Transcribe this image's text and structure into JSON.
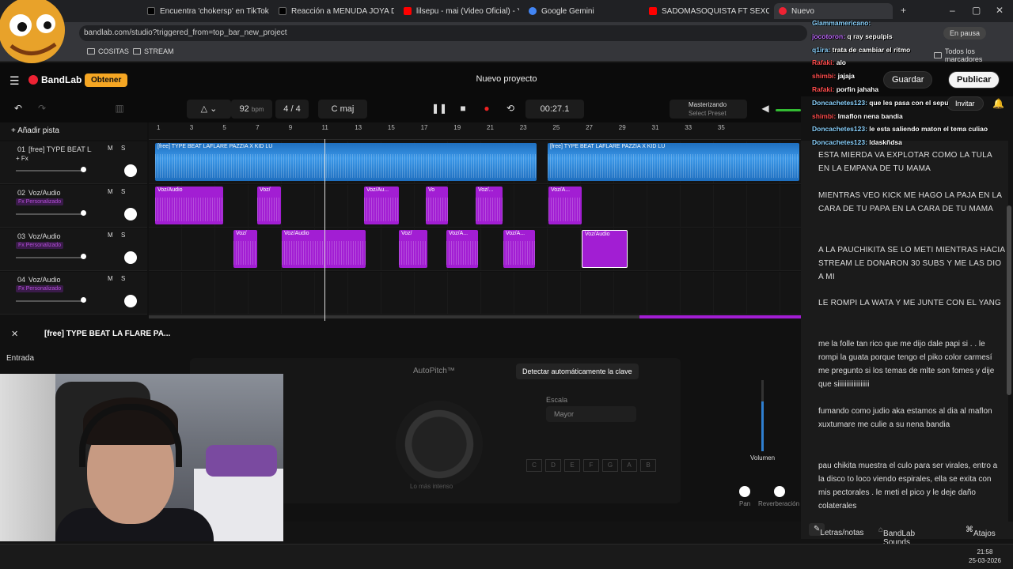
{
  "browser": {
    "tabs": [
      {
        "title": "Encuentra 'chokersp' en TikTok",
        "color": "#000000"
      },
      {
        "title": "Reacción a MENUDA JOYA DYS",
        "color": "#000000"
      },
      {
        "title": "lilsepu - mai (Video Oficial) - Yo",
        "color": "#ff0000"
      },
      {
        "title": "Google Gemini",
        "color": "#4285f4"
      },
      {
        "title": "SADOMASOQUISTA FT SEXO //",
        "color": "#ff0000"
      },
      {
        "title": "Nuevo",
        "color": "#e23"
      }
    ],
    "url": "bandlab.com/studio?triggered_from=top_bar_new_project",
    "paused_label": "En pausa",
    "bookmarks": [
      "COSITAS",
      "STREAM"
    ],
    "all_bookmarks": "Todos los marcadores"
  },
  "app": {
    "logo": "BandLab",
    "get_label": "Obtener",
    "project_title": "Nuevo proyecto",
    "save_label": "Guardar",
    "publish_label": "Publicar",
    "invite_label": "Invitar",
    "mastering_label": "Masterizando",
    "preset_label": "Select Preset"
  },
  "transport": {
    "bpm": "92",
    "bpm_unit": "bpm",
    "signature": "4 / 4",
    "key": "C maj",
    "time": "00:27.1"
  },
  "tracks_panel": {
    "add_track": "Añadir pista",
    "ruler": [
      "1",
      "3",
      "5",
      "7",
      "9",
      "11",
      "13",
      "15",
      "17",
      "19",
      "21",
      "23",
      "25",
      "27",
      "29",
      "31",
      "33",
      "35"
    ],
    "tracks": [
      {
        "num": "01",
        "name": "[free] TYPE BEAT L...",
        "sub": "+ Fx"
      },
      {
        "num": "02",
        "name": "Voz/Audio",
        "sub": "Fx Personalizado"
      },
      {
        "num": "03",
        "name": "Voz/Audio",
        "sub": "Fx Personalizado"
      },
      {
        "num": "04",
        "name": "Voz/Audio",
        "sub": "Fx Personalizado"
      }
    ],
    "beat_clip_label": "[free] TYPE BEAT LAFLARE PAZZIA X KID LU",
    "clip_labels": [
      "Voz/Audio",
      "Voz/",
      "Voz/Au...",
      "Vo",
      "Voz/...",
      "Voz/A...",
      "Voz/",
      "Voz/A...",
      "Voz/A...",
      "Voz/Audio"
    ]
  },
  "bottom_panel": {
    "selected_track": "[free] TYPE BEAT LA FLARE PA...",
    "input_label": "Entrada",
    "autopitch": "AutoPitch™",
    "detect_key": "Detectar automáticamente la clave",
    "scale_label": "Escala",
    "scale_value": "Mayor",
    "intensity": "Lo más intenso",
    "volume_label": "Volumen",
    "pan_label": "Pan",
    "reverb_label": "Reverberación",
    "keys": [
      "C",
      "D",
      "E",
      "F",
      "G",
      "A",
      "B"
    ]
  },
  "lyrics": {
    "blocks": [
      "ESTA MIERDA VA EXPLOTAR COMO LA TULA EN LA EMPANA DE TU MAMA",
      "MIENTRAS VEO KICK ME HAGO LA PAJA EN LA CARA DE TU PAPA EN LA CARA DE TU MAMA",
      "A LA PAUCHIKITA SE LO METI MIENTRAS HACIA STREAM LE DONARON 30 SUBS Y ME LAS DIO A MI",
      "LE ROMPI LA WATA Y ME JUNTE CON EL YANG",
      "me la folle tan rico que me dijo dale papi si . . le rompi la guata porque tengo el piko color carmesí  me pregunto si los temas de mlte son fomes y dije que siiiiiiiiiiiiiiiiii",
      "fumando como judio aka estamos al dia al maflon xuxtumare me culie a su nena bandia",
      "pau chikita muestra el culo para ser virales, entro a la disco to loco viendo espirales, ella se exita con mis pectorales . le meti el pico y le deje daño colaterales"
    ]
  },
  "bottom_strip": {
    "lyrics_tab": "Letras/notas",
    "sounds_tab": "BandLab Sounds",
    "shortcuts_tab": "Atajos"
  },
  "chat": [
    {
      "user": "Glammamericano:",
      "text": "",
      "color": "#8bd3ff"
    },
    {
      "user": "jocotoron:",
      "text": "q ray sepulpis",
      "color": "#c06bff"
    },
    {
      "user": "q1ira:",
      "text": "trata de cambiar el ritmo",
      "color": "#8bd3ff"
    },
    {
      "user": "Rafaki:",
      "text": "alo",
      "color": "#ff4d4d"
    },
    {
      "user": "shimbi:",
      "text": "jajaja",
      "color": "#ff4d4d"
    },
    {
      "user": "Rafaki:",
      "text": "porfin jahaha",
      "color": "#ff4d4d"
    },
    {
      "user": "Doncachetes123:",
      "text": "que les pasa con el sepu",
      "color": "#8bd3ff"
    },
    {
      "user": "shimbi:",
      "text": "lmaflon nena bandia",
      "color": "#ff4d4d"
    },
    {
      "user": "Doncachetes123:",
      "text": "le esta saliendo maton el tema culiao",
      "color": "#8bd3ff"
    },
    {
      "user": "Doncachetes123:",
      "text": "ldaskñdsa",
      "color": "#8bd3ff"
    }
  ],
  "taskbar": {
    "time": "21:58",
    "date": "25-03-2026"
  }
}
